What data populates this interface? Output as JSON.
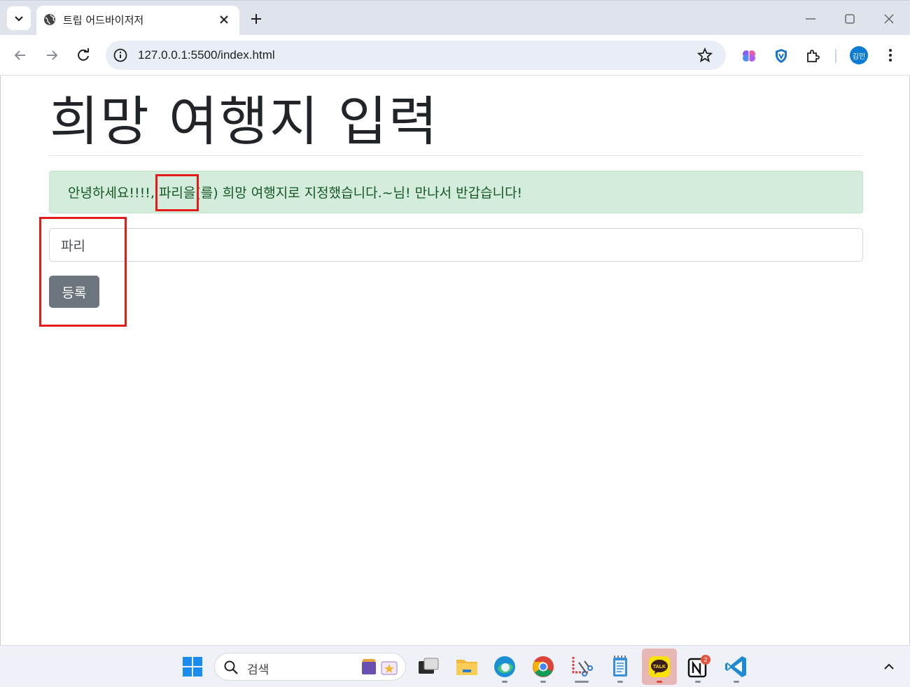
{
  "browser": {
    "tab_title": "트립 어드바이저저",
    "url": "127.0.0.1:5500/index.html",
    "profile_label": "김민"
  },
  "page": {
    "heading": "희망 여행지 입력",
    "alert_message": "안녕하세요!!!!, 파리을(를) 희망 여행지로 지정했습니다.~님! 만나서 반갑습니다!",
    "input_value": "파리",
    "submit_label": "등록"
  },
  "taskbar": {
    "search_placeholder": "검색",
    "notion_badge": "2",
    "kakao_label": "TALK"
  },
  "colors": {
    "alert_bg": "#d4ecdb",
    "alert_text": "#155724",
    "button_bg": "#6c757d",
    "annotation": "#e21b1b"
  }
}
